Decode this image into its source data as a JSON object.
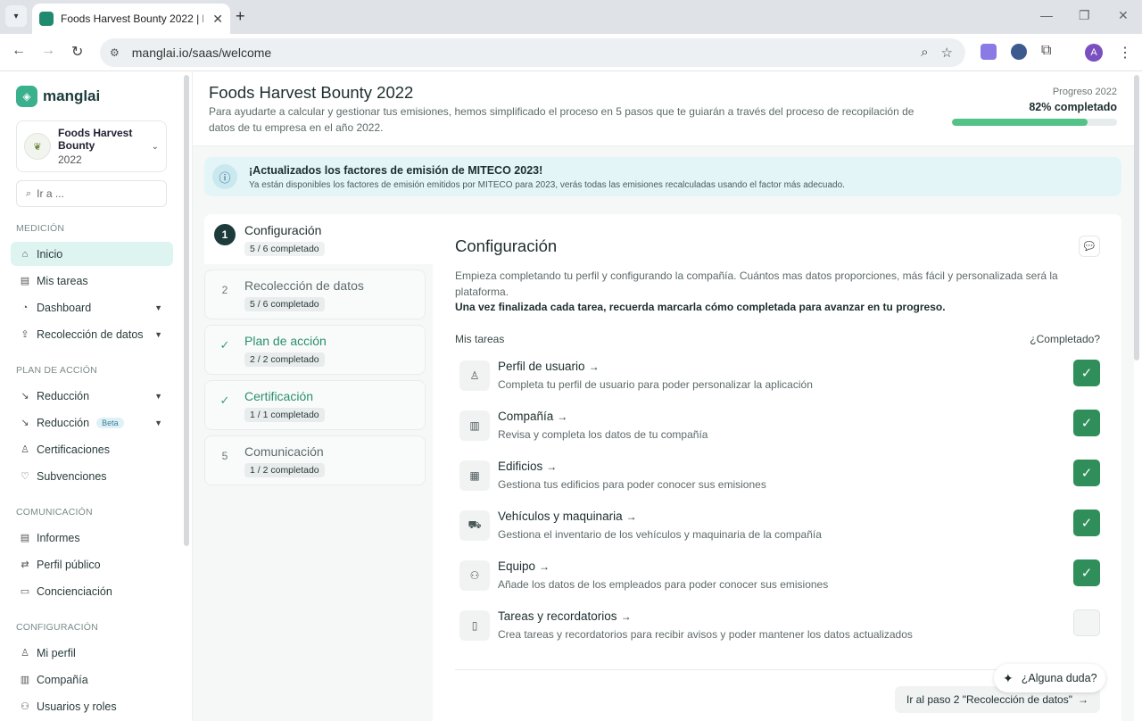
{
  "browser": {
    "tab_title": "Foods Harvest Bounty 2022 | M",
    "url": "manglai.io/saas/welcome",
    "profile_initial": "A"
  },
  "sidebar": {
    "logo_text": "manglai",
    "company": {
      "name": "Foods Harvest Bounty",
      "year": "2022"
    },
    "search_placeholder": "Ir a ...",
    "sections": {
      "medicion": "MEDICIÓN",
      "plan": "PLAN DE ACCIÓN",
      "comunicacion": "COMUNICACIÓN",
      "configuracion": "CONFIGURACIÓN"
    },
    "items": {
      "inicio": "Inicio",
      "tareas": "Mis tareas",
      "dashboard": "Dashboard",
      "recoleccion": "Recolección de datos",
      "reduccion1": "Reducción",
      "reduccion2": "Reducción",
      "beta": "Beta",
      "certificaciones": "Certificaciones",
      "subvenciones": "Subvenciones",
      "informes": "Informes",
      "perfil_publico": "Perfil público",
      "concienciacion": "Concienciación",
      "mi_perfil": "Mi perfil",
      "compania": "Compañía",
      "usuarios": "Usuarios y roles"
    }
  },
  "header": {
    "title": "Foods Harvest Bounty 2022",
    "description": "Para ayudarte a calcular y gestionar tus emisiones, hemos simplificado el proceso en 5 pasos que te guiarán a través del proceso de recopilación de datos de tu empresa en el año 2022.",
    "progress_label": "Progreso 2022",
    "progress_text": "82% completado",
    "progress_fraction": 0.82
  },
  "banner": {
    "title": "¡Actualizados los factores de emisión de MITECO 2023!",
    "text": "Ya están disponibles los factores de emisión emitidos por MITECO para 2023, verás todas las emisiones recalculadas usando el factor más adecuado."
  },
  "steps": [
    {
      "num": "1",
      "title": "Configuración",
      "count": "5 / 6 completado"
    },
    {
      "num": "2",
      "title": "Recolección de datos",
      "count": "5 / 6 completado"
    },
    {
      "num": "✓",
      "title": "Plan de acción",
      "count": "2 / 2 completado"
    },
    {
      "num": "✓",
      "title": "Certificación",
      "count": "1 / 1 completado"
    },
    {
      "num": "5",
      "title": "Comunicación",
      "count": "1 / 2 completado"
    }
  ],
  "card": {
    "title": "Configuración",
    "description": "Empieza completando tu perfil y configurando la compañía. Cuántos mas datos proporciones, más fácil y personalizada será la plataforma.",
    "bold_note": "Una vez finalizada cada tarea, recuerda marcarla cómo completada para avanzar en tu progreso.",
    "col_left": "Mis tareas",
    "col_right": "¿Completado?",
    "tasks": [
      {
        "title": "Perfil de usuario",
        "sub": "Completa tu perfil de usuario para poder personalizar la aplicación",
        "done": true
      },
      {
        "title": "Compañía",
        "sub": "Revisa y completa los datos de tu compañía",
        "done": true
      },
      {
        "title": "Edificios",
        "sub": "Gestiona tus edificios para poder conocer sus emisiones",
        "done": true
      },
      {
        "title": "Vehículos y maquinaria",
        "sub": "Gestiona el inventario de los vehículos y maquinaria de la compañía",
        "done": true
      },
      {
        "title": "Equipo",
        "sub": "Añade los datos de los empleados para poder conocer sus emisiones",
        "done": true
      },
      {
        "title": "Tareas y recordatorios",
        "sub": "Crea tareas y recordatorios para recibir avisos y poder mantener los datos actualizados",
        "done": false
      }
    ],
    "help_label": "¿Alguna duda?",
    "next_label": "Ir al paso 2 \"Recolección de datos\""
  }
}
